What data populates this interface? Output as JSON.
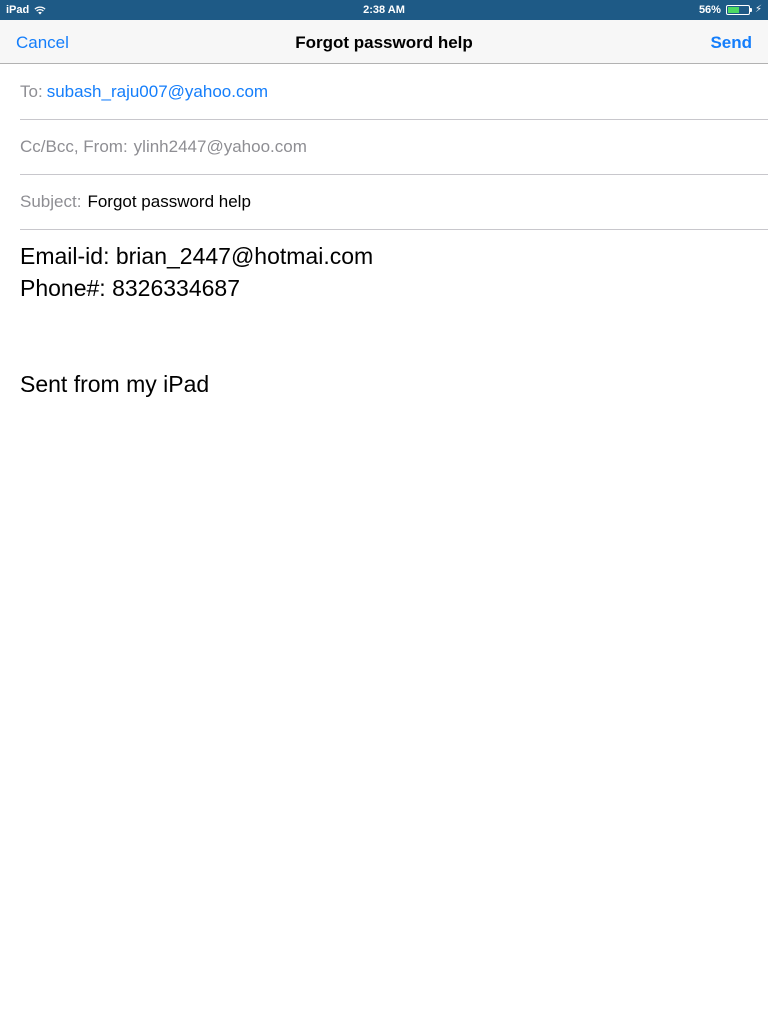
{
  "status_bar": {
    "device": "iPad",
    "time": "2:38 AM",
    "battery_percent_label": "56%",
    "battery_level": 0.56,
    "charging": true
  },
  "nav": {
    "cancel_label": "Cancel",
    "title": "Forgot password help",
    "send_label": "Send"
  },
  "fields": {
    "to_label": "To:",
    "to_value": "subash_raju007@yahoo.com",
    "ccbcc_label": "Cc/Bcc, From:",
    "from_value": "ylinh2447@yahoo.com",
    "subject_label": "Subject:",
    "subject_value": "Forgot password help"
  },
  "body": {
    "line1": "Email-id: brian_2447@hotmai.com",
    "line2": "Phone#: 8326334687",
    "signature": "Sent from my iPad"
  },
  "colors": {
    "status_bar": "#1e5a86",
    "accent": "#147efb",
    "muted": "#8e8e93",
    "battery": "#4cd964"
  }
}
